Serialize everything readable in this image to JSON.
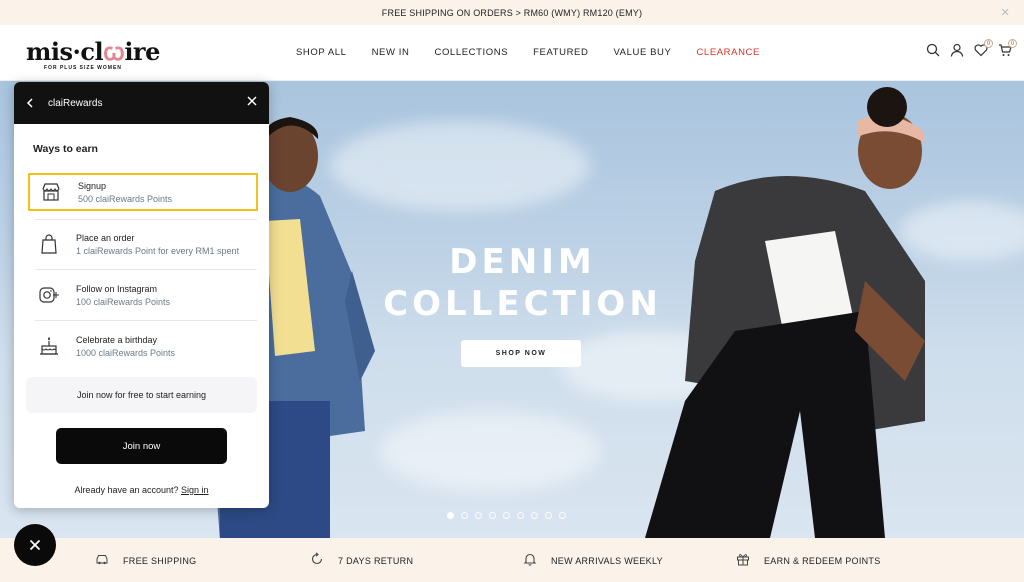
{
  "announcement": {
    "text": "FREE SHIPPING ON ORDERS > RM60 (WMY) RM120 (EMY)"
  },
  "brand": {
    "name_left": "mis·cl",
    "name_right": "ire",
    "tagline": "FOR PLUS SIZE WOMEN"
  },
  "nav": {
    "items": [
      {
        "label": "SHOP ALL"
      },
      {
        "label": "NEW IN"
      },
      {
        "label": "COLLECTIONS"
      },
      {
        "label": "FEATURED"
      },
      {
        "label": "VALUE BUY"
      },
      {
        "label": "CLEARANCE"
      }
    ]
  },
  "header_icons": {
    "wishlist_count": "0",
    "cart_count": "0"
  },
  "hero": {
    "title_line1": "DENIM",
    "title_line2": "COLLECTION",
    "cta": "SHOP NOW",
    "slide_count": 9,
    "active_slide": 1
  },
  "rewards_panel": {
    "title": "claiRewards",
    "section_title": "Ways to earn",
    "items": [
      {
        "title": "Signup",
        "subtitle": "500 claiRewards Points",
        "icon": "storefront-icon"
      },
      {
        "title": "Place an order",
        "subtitle": "1 claiRewards Point for every RM1 spent",
        "icon": "shopping-bag-icon"
      },
      {
        "title": "Follow on Instagram",
        "subtitle": "100 claiRewards Points",
        "icon": "instagram-icon"
      },
      {
        "title": "Celebrate a birthday",
        "subtitle": "1000 claiRewards Points",
        "icon": "cake-icon"
      }
    ],
    "join_message": "Join now for free to start earning",
    "join_button": "Join now",
    "signin_prefix": "Already have an account?",
    "signin_link": "Sign in"
  },
  "features": [
    {
      "label": "FREE SHIPPING",
      "icon": "car-icon"
    },
    {
      "label": "7 DAYS RETURN",
      "icon": "return-icon"
    },
    {
      "label": "NEW ARRIVALS WEEKLY",
      "icon": "bell-icon"
    },
    {
      "label": "EARN & REDEEM POINTS",
      "icon": "gift-icon"
    }
  ],
  "colors": {
    "accent_clearance": "#d9342b",
    "highlight_border": "#f3c21a",
    "cream": "#fbf2ea"
  }
}
